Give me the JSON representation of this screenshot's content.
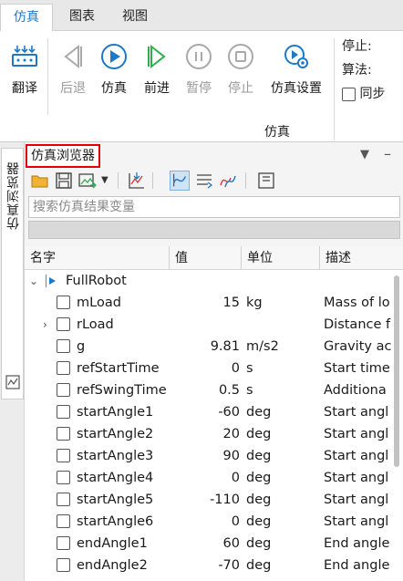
{
  "tabs": [
    "仿真",
    "图表",
    "视图"
  ],
  "ribbon": {
    "translate": "翻译",
    "back": "后退",
    "simulate": "仿真",
    "forward": "前进",
    "pause": "暂停",
    "stop": "停止",
    "settings": "仿真设置",
    "group_label": "仿真",
    "stop_label": "停止:",
    "algorithm_label": "算法:",
    "sync_label": "同步"
  },
  "side_tab": "仿真浏览器",
  "panel": {
    "title": "仿真浏览器",
    "search_placeholder": "搜索仿真结果变量",
    "columns": [
      "名字",
      "值",
      "单位",
      "描述"
    ]
  },
  "tree": {
    "root": "FullRobot",
    "rows": [
      {
        "name": "mLoad",
        "value": "15",
        "unit": "kg",
        "desc": "Mass of lo",
        "expandable": false
      },
      {
        "name": "rLoad",
        "value": "",
        "unit": "",
        "desc": "Distance f",
        "expandable": true
      },
      {
        "name": "g",
        "value": "9.81",
        "unit": "m/s2",
        "desc": "Gravity ac",
        "expandable": false
      },
      {
        "name": "refStartTime",
        "value": "0",
        "unit": "s",
        "desc": "Start time",
        "expandable": false
      },
      {
        "name": "refSwingTime",
        "value": "0.5",
        "unit": "s",
        "desc": "Additiona",
        "expandable": false
      },
      {
        "name": "startAngle1",
        "value": "-60",
        "unit": "deg",
        "desc": "Start angl",
        "expandable": false
      },
      {
        "name": "startAngle2",
        "value": "20",
        "unit": "deg",
        "desc": "Start angl",
        "expandable": false
      },
      {
        "name": "startAngle3",
        "value": "90",
        "unit": "deg",
        "desc": "Start angl",
        "expandable": false
      },
      {
        "name": "startAngle4",
        "value": "0",
        "unit": "deg",
        "desc": "Start angl",
        "expandable": false
      },
      {
        "name": "startAngle5",
        "value": "-110",
        "unit": "deg",
        "desc": "Start angl",
        "expandable": false
      },
      {
        "name": "startAngle6",
        "value": "0",
        "unit": "deg",
        "desc": "Start angl",
        "expandable": false
      },
      {
        "name": "endAngle1",
        "value": "60",
        "unit": "deg",
        "desc": "End angle",
        "expandable": false
      },
      {
        "name": "endAngle2",
        "value": "-70",
        "unit": "deg",
        "desc": "End angle",
        "expandable": false
      }
    ]
  },
  "colors": {
    "accent": "#1f78c4",
    "highlight_border": "#e00000",
    "sim_green": "#2fae4e"
  }
}
